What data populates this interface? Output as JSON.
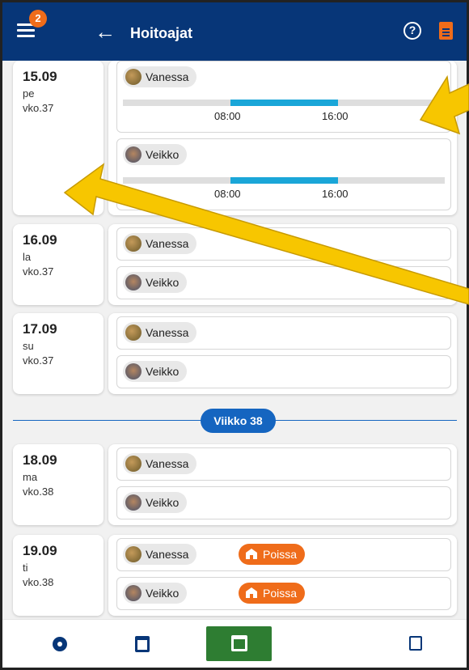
{
  "appbar": {
    "title": "Hoitoajat",
    "notification_count": "2",
    "back_icon": "arrow-left-icon",
    "help_icon": "help-circle-icon",
    "doc_icon": "document-icon"
  },
  "colors": {
    "appbar": "#073678",
    "accent": "#ef6c1a",
    "bar_fill": "#1aa6d8",
    "week_pill": "#1565c0",
    "active_tab": "#2e7d32",
    "annotation_arrow": "#f7c600"
  },
  "days": [
    {
      "date": "15.09",
      "weekday": "pe",
      "week": "vko.37",
      "persons": [
        {
          "name": "Vanessa",
          "start": "08:00",
          "end": "16:00"
        },
        {
          "name": "Veikko",
          "start": "08:00",
          "end": "16:00"
        }
      ]
    },
    {
      "date": "16.09",
      "weekday": "la",
      "week": "vko.37",
      "persons": [
        {
          "name": "Vanessa"
        },
        {
          "name": "Veikko"
        }
      ]
    },
    {
      "date": "17.09",
      "weekday": "su",
      "week": "vko.37",
      "persons": [
        {
          "name": "Vanessa"
        },
        {
          "name": "Veikko"
        }
      ]
    },
    {
      "date": "18.09",
      "weekday": "ma",
      "week": "vko.38",
      "persons": [
        {
          "name": "Vanessa"
        },
        {
          "name": "Veikko"
        }
      ]
    },
    {
      "date": "19.09",
      "weekday": "ti",
      "week": "vko.38",
      "persons": [
        {
          "name": "Vanessa",
          "absent": "Poissa"
        },
        {
          "name": "Veikko",
          "absent": "Poissa"
        }
      ]
    }
  ],
  "week_separator": "Viikko 38",
  "bottom_nav": [
    "settings-icon",
    "calendar-icon",
    "calendar-edit-icon",
    "bookmark-icon"
  ]
}
